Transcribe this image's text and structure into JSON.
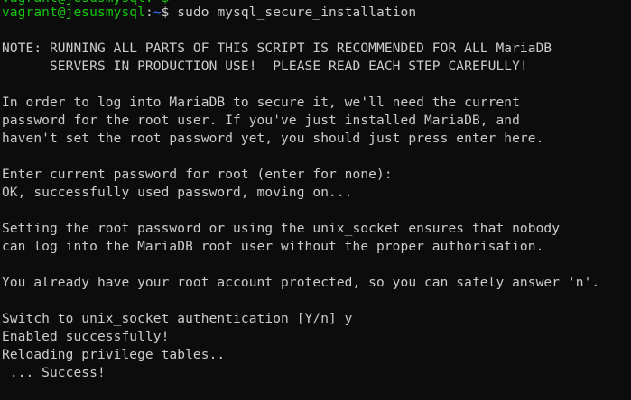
{
  "terminal": {
    "partial_top_line": "vagrant@jesusmysql:~$",
    "prompt": {
      "user_host": "vagrant@jesusmysql",
      "separator": ":",
      "path": "~",
      "symbol": "$ ",
      "command": "sudo mysql_secure_installation"
    },
    "lines": [
      "NOTE: RUNNING ALL PARTS OF THIS SCRIPT IS RECOMMENDED FOR ALL MariaDB",
      "      SERVERS IN PRODUCTION USE!  PLEASE READ EACH STEP CAREFULLY!",
      "",
      "In order to log into MariaDB to secure it, we'll need the current",
      "password for the root user. If you've just installed MariaDB, and",
      "haven't set the root password yet, you should just press enter here.",
      "",
      "Enter current password for root (enter for none):",
      "OK, successfully used password, moving on...",
      "",
      "Setting the root password or using the unix_socket ensures that nobody",
      "can log into the MariaDB root user without the proper authorisation.",
      "",
      "You already have your root account protected, so you can safely answer 'n'.",
      "",
      "Switch to unix_socket authentication [Y/n] y",
      "Enabled successfully!",
      "Reloading privilege tables..",
      " ... Success!"
    ]
  }
}
